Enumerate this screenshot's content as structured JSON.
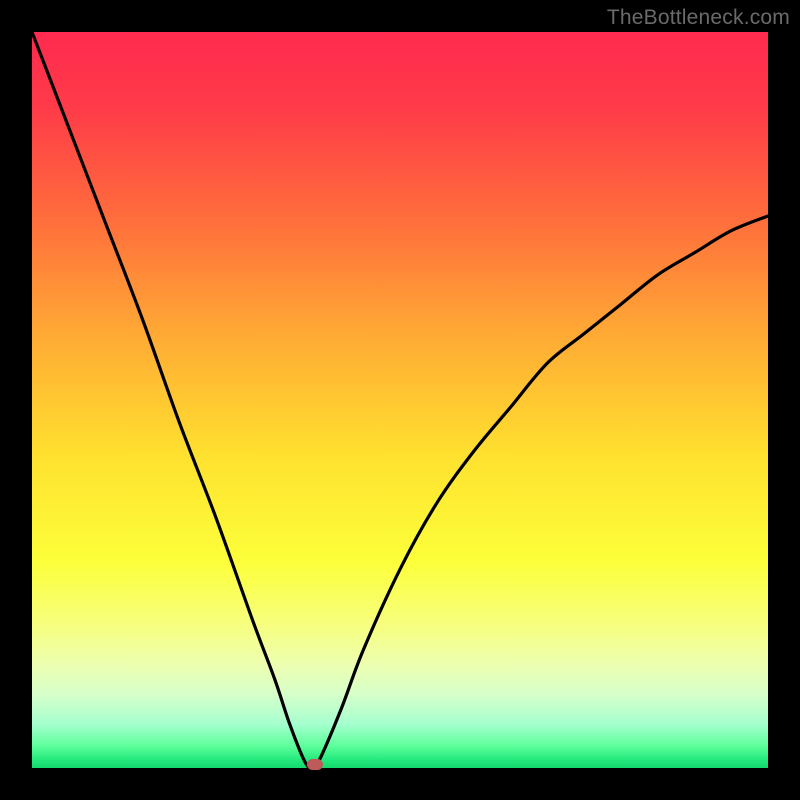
{
  "watermark": "TheBottleneck.com",
  "chart_data": {
    "type": "line",
    "title": "",
    "xlabel": "",
    "ylabel": "",
    "xlim": [
      0,
      100
    ],
    "ylim": [
      0,
      100
    ],
    "grid": false,
    "legend": false,
    "series": [
      {
        "name": "curve",
        "color": "#000000",
        "x": [
          0,
          5,
          10,
          15,
          20,
          25,
          30,
          33,
          35,
          37,
          38,
          39,
          42,
          45,
          50,
          55,
          60,
          65,
          70,
          75,
          80,
          85,
          90,
          95,
          100
        ],
        "y": [
          100,
          87,
          74,
          61,
          47,
          34,
          20,
          12,
          6,
          1,
          0,
          1,
          8,
          16,
          27,
          36,
          43,
          49,
          55,
          59,
          63,
          67,
          70,
          73,
          75
        ]
      }
    ],
    "marker": {
      "x": 38.5,
      "y": 0.5,
      "color": "#bd5a5a"
    },
    "gradient_stops": [
      {
        "pos": 0,
        "color": "#ff2a4f"
      },
      {
        "pos": 25,
        "color": "#ff6c3c"
      },
      {
        "pos": 50,
        "color": "#ffd32f"
      },
      {
        "pos": 75,
        "color": "#fbff4a"
      },
      {
        "pos": 90,
        "color": "#dcffc0"
      },
      {
        "pos": 100,
        "color": "#14d96e"
      }
    ]
  }
}
